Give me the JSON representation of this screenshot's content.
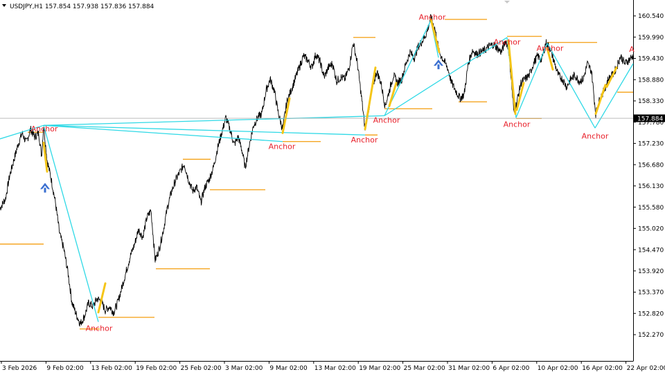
{
  "header": {
    "symbol_line": "USDJPY,H1  157.854 157.938 157.836 157.884"
  },
  "colors": {
    "price": "#000000",
    "zigzag": "#2fd9e6",
    "level": "#f5a623",
    "impulse": "#f5c518",
    "anchor_text": "#e8212b",
    "arrow": "#3a6fd0",
    "price_box_bg": "#000000"
  },
  "chart_data": {
    "type": "line",
    "title": "USDJPY,H1",
    "ohlc_last": {
      "open": 157.854,
      "high": 157.938,
      "low": 157.836,
      "close": 157.884
    },
    "current_price_label": "157.884",
    "current_price": 157.884,
    "ylim": [
      152.0,
      160.8
    ],
    "y_ticks": [
      "160.540",
      "159.990",
      "159.430",
      "158.880",
      "158.330",
      "157.780",
      "157.230",
      "156.680",
      "156.130",
      "155.580",
      "155.020",
      "154.470",
      "153.920",
      "153.370",
      "152.820",
      "152.270"
    ],
    "x_ticks": [
      "3 Feb 2026",
      "9 Feb 02:00",
      "13 Feb 02:00",
      "19 Feb 02:00",
      "25 Feb 02:00",
      "3 Mar 02:00",
      "9 Mar 02:00",
      "13 Mar 02:00",
      "19 Mar 02:00",
      "25 Mar 02:00",
      "31 Mar 02:00",
      "6 Apr 02:00",
      "10 Apr 02:00",
      "16 Apr 02:00",
      "22 Apr 02:00"
    ],
    "price_path": [
      [
        0,
        155.55
      ],
      [
        8,
        155.8
      ],
      [
        14,
        156.4
      ],
      [
        20,
        156.8
      ],
      [
        26,
        157.2
      ],
      [
        32,
        157.5
      ],
      [
        38,
        157.25
      ],
      [
        44,
        157.6
      ],
      [
        50,
        157.4
      ],
      [
        56,
        157.5
      ],
      [
        60,
        156.9
      ],
      [
        63,
        157.7
      ],
      [
        68,
        156.8
      ],
      [
        74,
        156.3
      ],
      [
        80,
        155.7
      ],
      [
        86,
        154.9
      ],
      [
        92,
        154.5
      ],
      [
        98,
        153.9
      ],
      [
        104,
        153.1
      ],
      [
        110,
        152.8
      ],
      [
        116,
        152.55
      ],
      [
        122,
        152.75
      ],
      [
        128,
        153.1
      ],
      [
        134,
        153.0
      ],
      [
        140,
        153.2
      ],
      [
        146,
        153.15
      ],
      [
        152,
        152.9
      ],
      [
        158,
        153.0
      ],
      [
        164,
        152.85
      ],
      [
        170,
        153.1
      ],
      [
        176,
        153.5
      ],
      [
        182,
        153.9
      ],
      [
        188,
        154.3
      ],
      [
        194,
        154.6
      ],
      [
        200,
        155.0
      ],
      [
        206,
        154.8
      ],
      [
        212,
        155.3
      ],
      [
        218,
        155.5
      ],
      [
        224,
        154.2
      ],
      [
        230,
        154.5
      ],
      [
        236,
        155.0
      ],
      [
        242,
        155.6
      ],
      [
        248,
        156.0
      ],
      [
        254,
        156.3
      ],
      [
        260,
        156.5
      ],
      [
        266,
        156.7
      ],
      [
        272,
        156.3
      ],
      [
        278,
        156.0
      ],
      [
        284,
        156.1
      ],
      [
        290,
        155.7
      ],
      [
        296,
        156.1
      ],
      [
        302,
        156.3
      ],
      [
        308,
        156.6
      ],
      [
        314,
        157.1
      ],
      [
        320,
        157.5
      ],
      [
        326,
        157.9
      ],
      [
        332,
        157.6
      ],
      [
        338,
        157.2
      ],
      [
        344,
        157.4
      ],
      [
        350,
        157.0
      ],
      [
        354,
        156.6
      ],
      [
        360,
        157.2
      ],
      [
        366,
        157.7
      ],
      [
        372,
        157.9
      ],
      [
        378,
        158.0
      ],
      [
        384,
        158.6
      ],
      [
        390,
        158.9
      ],
      [
        396,
        158.6
      ],
      [
        402,
        158.0
      ],
      [
        408,
        157.6
      ],
      [
        414,
        158.3
      ],
      [
        420,
        158.6
      ],
      [
        426,
        158.9
      ],
      [
        432,
        159.2
      ],
      [
        438,
        159.5
      ],
      [
        444,
        159.4
      ],
      [
        450,
        159.2
      ],
      [
        456,
        159.55
      ],
      [
        462,
        159.35
      ],
      [
        468,
        158.95
      ],
      [
        474,
        159.2
      ],
      [
        480,
        159.3
      ],
      [
        486,
        158.85
      ],
      [
        492,
        158.95
      ],
      [
        498,
        158.9
      ],
      [
        504,
        159.2
      ],
      [
        510,
        159.85
      ],
      [
        516,
        159.3
      ],
      [
        522,
        158.4
      ],
      [
        527,
        157.6
      ],
      [
        532,
        158.1
      ],
      [
        538,
        158.7
      ],
      [
        544,
        159.1
      ],
      [
        550,
        158.8
      ],
      [
        556,
        158.2
      ],
      [
        562,
        158.6
      ],
      [
        568,
        159.0
      ],
      [
        574,
        158.8
      ],
      [
        580,
        158.9
      ],
      [
        586,
        159.3
      ],
      [
        592,
        159.6
      ],
      [
        598,
        159.45
      ],
      [
        604,
        159.75
      ],
      [
        610,
        159.9
      ],
      [
        616,
        160.1
      ],
      [
        622,
        160.5
      ],
      [
        628,
        160.2
      ],
      [
        634,
        159.6
      ],
      [
        640,
        159.4
      ],
      [
        646,
        159.2
      ],
      [
        652,
        158.8
      ],
      [
        658,
        158.6
      ],
      [
        664,
        158.4
      ],
      [
        670,
        158.5
      ],
      [
        676,
        159.3
      ],
      [
        682,
        159.65
      ],
      [
        688,
        159.55
      ],
      [
        694,
        159.6
      ],
      [
        700,
        159.65
      ],
      [
        706,
        159.75
      ],
      [
        712,
        159.8
      ],
      [
        718,
        159.7
      ],
      [
        724,
        159.6
      ],
      [
        730,
        159.9
      ],
      [
        734,
        159.7
      ],
      [
        738,
        158.9
      ],
      [
        742,
        158.0
      ],
      [
        746,
        158.3
      ],
      [
        752,
        158.8
      ],
      [
        758,
        158.9
      ],
      [
        764,
        159.0
      ],
      [
        770,
        159.3
      ],
      [
        776,
        159.5
      ],
      [
        782,
        159.4
      ],
      [
        788,
        159.85
      ],
      [
        794,
        159.7
      ],
      [
        800,
        159.35
      ],
      [
        806,
        159.0
      ],
      [
        812,
        158.9
      ],
      [
        818,
        158.7
      ],
      [
        824,
        158.9
      ],
      [
        830,
        159.0
      ],
      [
        836,
        158.85
      ],
      [
        842,
        158.9
      ],
      [
        848,
        159.3
      ],
      [
        854,
        159.1
      ],
      [
        860,
        158.0
      ],
      [
        866,
        158.4
      ],
      [
        872,
        158.6
      ],
      [
        878,
        158.9
      ],
      [
        884,
        159.0
      ],
      [
        890,
        159.2
      ],
      [
        896,
        159.5
      ],
      [
        902,
        159.3
      ],
      [
        908,
        159.4
      ],
      [
        914,
        159.5
      ]
    ],
    "zigzag_lines": [
      [
        [
          0,
          157.35
        ],
        [
          63,
          157.7
        ]
      ],
      [
        [
          63,
          157.7
        ],
        [
          142,
          152.6
        ]
      ],
      [
        [
          63,
          157.7
        ],
        [
          408,
          157.28
        ]
      ],
      [
        [
          63,
          157.7
        ],
        [
          527,
          157.45
        ]
      ],
      [
        [
          63,
          157.7
        ],
        [
          555,
          157.95
        ]
      ],
      [
        [
          555,
          157.95
        ],
        [
          732,
          159.98
        ]
      ],
      [
        [
          555,
          157.95
        ],
        [
          622,
          160.42
        ]
      ],
      [
        [
          622,
          160.42
        ],
        [
          633,
          159.46
        ]
      ],
      [
        [
          732,
          159.98
        ],
        [
          745,
          157.9
        ]
      ],
      [
        [
          745,
          157.9
        ],
        [
          790,
          159.83
        ]
      ],
      [
        [
          790,
          159.83
        ],
        [
          859,
          157.63
        ]
      ],
      [
        [
          859,
          157.63
        ],
        [
          914,
          159.3
        ]
      ]
    ],
    "impulse_lines": [
      [
        [
          63,
          157.25
        ],
        [
          68,
          156.5
        ]
      ],
      [
        [
          142,
          152.85
        ],
        [
          152,
          153.6
        ]
      ],
      [
        [
          408,
          157.5
        ],
        [
          418,
          158.4
        ]
      ],
      [
        [
          527,
          157.6
        ],
        [
          542,
          159.2
        ]
      ],
      [
        [
          562,
          158.2
        ],
        [
          572,
          158.8
        ]
      ],
      [
        [
          622,
          160.45
        ],
        [
          634,
          159.6
        ]
      ],
      [
        [
          734,
          159.9
        ],
        [
          744,
          158.0
        ]
      ],
      [
        [
          746,
          158.1
        ],
        [
          756,
          158.8
        ]
      ],
      [
        [
          790,
          159.7
        ],
        [
          798,
          159.15
        ]
      ],
      [
        [
          860,
          158.0
        ],
        [
          874,
          158.75
        ]
      ],
      [
        [
          876,
          158.7
        ],
        [
          890,
          159.2
        ]
      ]
    ],
    "levels": [
      {
        "x1": 0,
        "x2": 63,
        "price": 154.62
      },
      {
        "x1": 40,
        "x2": 63,
        "price": 157.52
      },
      {
        "x1": 115,
        "x2": 144,
        "price": 152.42
      },
      {
        "x1": 142,
        "x2": 223,
        "price": 152.72
      },
      {
        "x1": 225,
        "x2": 303,
        "price": 153.98
      },
      {
        "x1": 264,
        "x2": 304,
        "price": 156.82
      },
      {
        "x1": 303,
        "x2": 383,
        "price": 156.03
      },
      {
        "x1": 408,
        "x2": 463,
        "price": 157.28
      },
      {
        "x1": 510,
        "x2": 542,
        "price": 159.98
      },
      {
        "x1": 527,
        "x2": 545,
        "price": 157.45
      },
      {
        "x1": 555,
        "x2": 624,
        "price": 158.13
      },
      {
        "x1": 642,
        "x2": 703,
        "price": 160.45
      },
      {
        "x1": 662,
        "x2": 703,
        "price": 158.31
      },
      {
        "x1": 732,
        "x2": 782,
        "price": 160.01
      },
      {
        "x1": 745,
        "x2": 782,
        "price": 157.88
      },
      {
        "x1": 790,
        "x2": 862,
        "price": 159.85
      },
      {
        "x1": 891,
        "x2": 914,
        "price": 158.56
      }
    ],
    "anchors": [
      {
        "text": "Anchor",
        "x": 64,
        "price": 157.62
      },
      {
        "text": "Anchor",
        "x": 143,
        "price": 152.44
      },
      {
        "text": "Anchor",
        "x": 407,
        "price": 157.16
      },
      {
        "text": "Anchor",
        "x": 526,
        "price": 157.33
      },
      {
        "text": "Anchor",
        "x": 558,
        "price": 157.84
      },
      {
        "text": "Anchor",
        "x": 624,
        "price": 160.51
      },
      {
        "text": "Anchor",
        "x": 732,
        "price": 159.87
      },
      {
        "text": "Anchor",
        "x": 746,
        "price": 157.73
      },
      {
        "text": "Anchor",
        "x": 794,
        "price": 159.71
      },
      {
        "text": "Anchor",
        "x": 859,
        "price": 157.43
      },
      {
        "text": "A",
        "x": 912,
        "price": 159.68
      }
    ],
    "arrows": [
      {
        "x": 65,
        "price": 156.1
      },
      {
        "x": 633,
        "price": 159.3
      }
    ]
  }
}
